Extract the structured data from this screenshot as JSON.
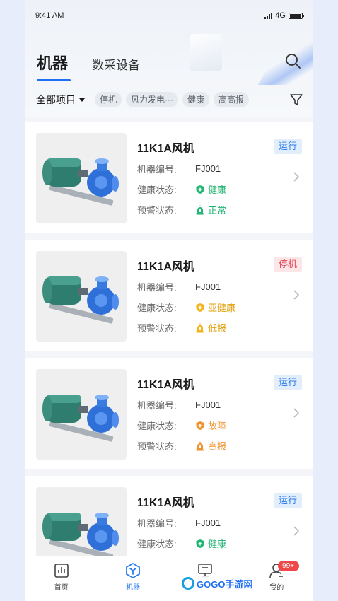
{
  "status_bar": {
    "time": "9:41 AM",
    "network": "4G"
  },
  "header": {
    "tab_active": "机器",
    "tab_other": "数采设备"
  },
  "filter": {
    "project": "全部项目",
    "chips": [
      "停机",
      "风力发电···",
      "健康",
      "高高报"
    ]
  },
  "colors": {
    "accent": "#1e6ff5",
    "health_ok": "#22b573",
    "health_sub": "#f2b418",
    "health_fault": "#f0932e",
    "alarm_red": "#e84a3d"
  },
  "cards": [
    {
      "title": "11K1A风机",
      "status": "运行",
      "code_label": "机器编号:",
      "code": "FJ001",
      "health_label": "健康状态:",
      "health": "健康",
      "alarm_label": "预警状态:",
      "alarm": "正常"
    },
    {
      "title": "11K1A风机",
      "status": "停机",
      "code_label": "机器编号:",
      "code": "FJ001",
      "health_label": "健康状态:",
      "health": "亚健康",
      "alarm_label": "预警状态:",
      "alarm": "低报"
    },
    {
      "title": "11K1A风机",
      "status": "运行",
      "code_label": "机器编号:",
      "code": "FJ001",
      "health_label": "健康状态:",
      "health": "故障",
      "alarm_label": "预警状态:",
      "alarm": "高报"
    },
    {
      "title": "11K1A风机",
      "status": "运行",
      "code_label": "机器编号:",
      "code": "FJ001",
      "health_label": "健康状态:",
      "health": "健康",
      "alarm_label": "预警状态:",
      "alarm": ""
    }
  ],
  "tabbar": {
    "items": [
      {
        "label": "首页",
        "icon": "chart-icon"
      },
      {
        "label": "机器",
        "icon": "machine-icon"
      },
      {
        "label": "",
        "icon": "monitor-icon"
      },
      {
        "label": "我的",
        "icon": "user-icon",
        "badge": "99+"
      }
    ]
  },
  "watermark": "GOGO手游网"
}
